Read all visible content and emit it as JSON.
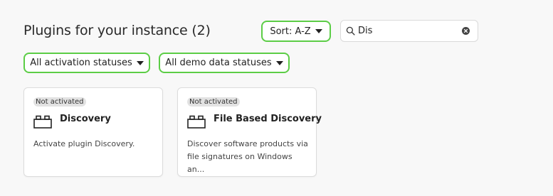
{
  "header": {
    "title": "Plugins for your instance (2)",
    "sort_label": "Sort: A-Z"
  },
  "search": {
    "value": "Dis",
    "icon": "search-icon",
    "clear_icon": "clear-icon"
  },
  "filters": {
    "activation_label": "All activation statuses",
    "demo_label": "All demo data statuses"
  },
  "colors": {
    "accent_border": "#5ccd46",
    "badge_bg": "#e2e2e2",
    "page_bg": "#f8f8f8"
  },
  "plugins": [
    {
      "status": "Not activated",
      "icon": "plugin-block-icon",
      "name": "Discovery",
      "description": "Activate plugin Discovery."
    },
    {
      "status": "Not activated",
      "icon": "plugin-block-icon",
      "name": "File Based Discovery",
      "description": "Discover software products via file signatures on Windows an..."
    }
  ]
}
